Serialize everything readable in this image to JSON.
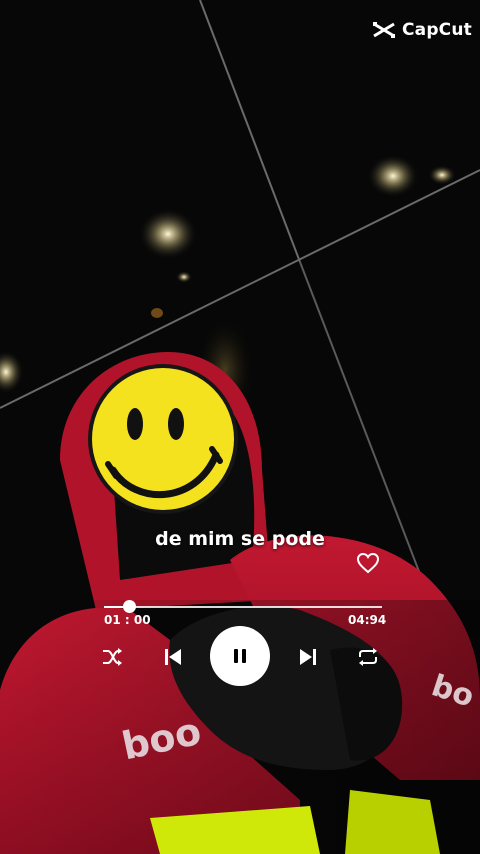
{
  "watermark": {
    "label": "CapCut",
    "icon": "capcut-logo-icon"
  },
  "player": {
    "lyric": "de mim se pode",
    "current_time": "01 : 00",
    "total_time": "04:94",
    "progress_fraction": 0.09,
    "state": "playing",
    "liked": false,
    "icons": {
      "like": "heart-icon",
      "shuffle": "shuffle-icon",
      "previous": "skip-previous-icon",
      "pause": "pause-icon",
      "next": "skip-next-icon",
      "repeat": "repeat-icon"
    }
  },
  "colors": {
    "control": "#ffffff",
    "emoji": "#f4e21f",
    "jacket": "#b2112a",
    "vest": "#d4f000"
  },
  "background": {
    "description_icon": "night-selfie-photo",
    "emoji_overlay": "smiley-face-icon",
    "jacket_logo": "boo"
  }
}
